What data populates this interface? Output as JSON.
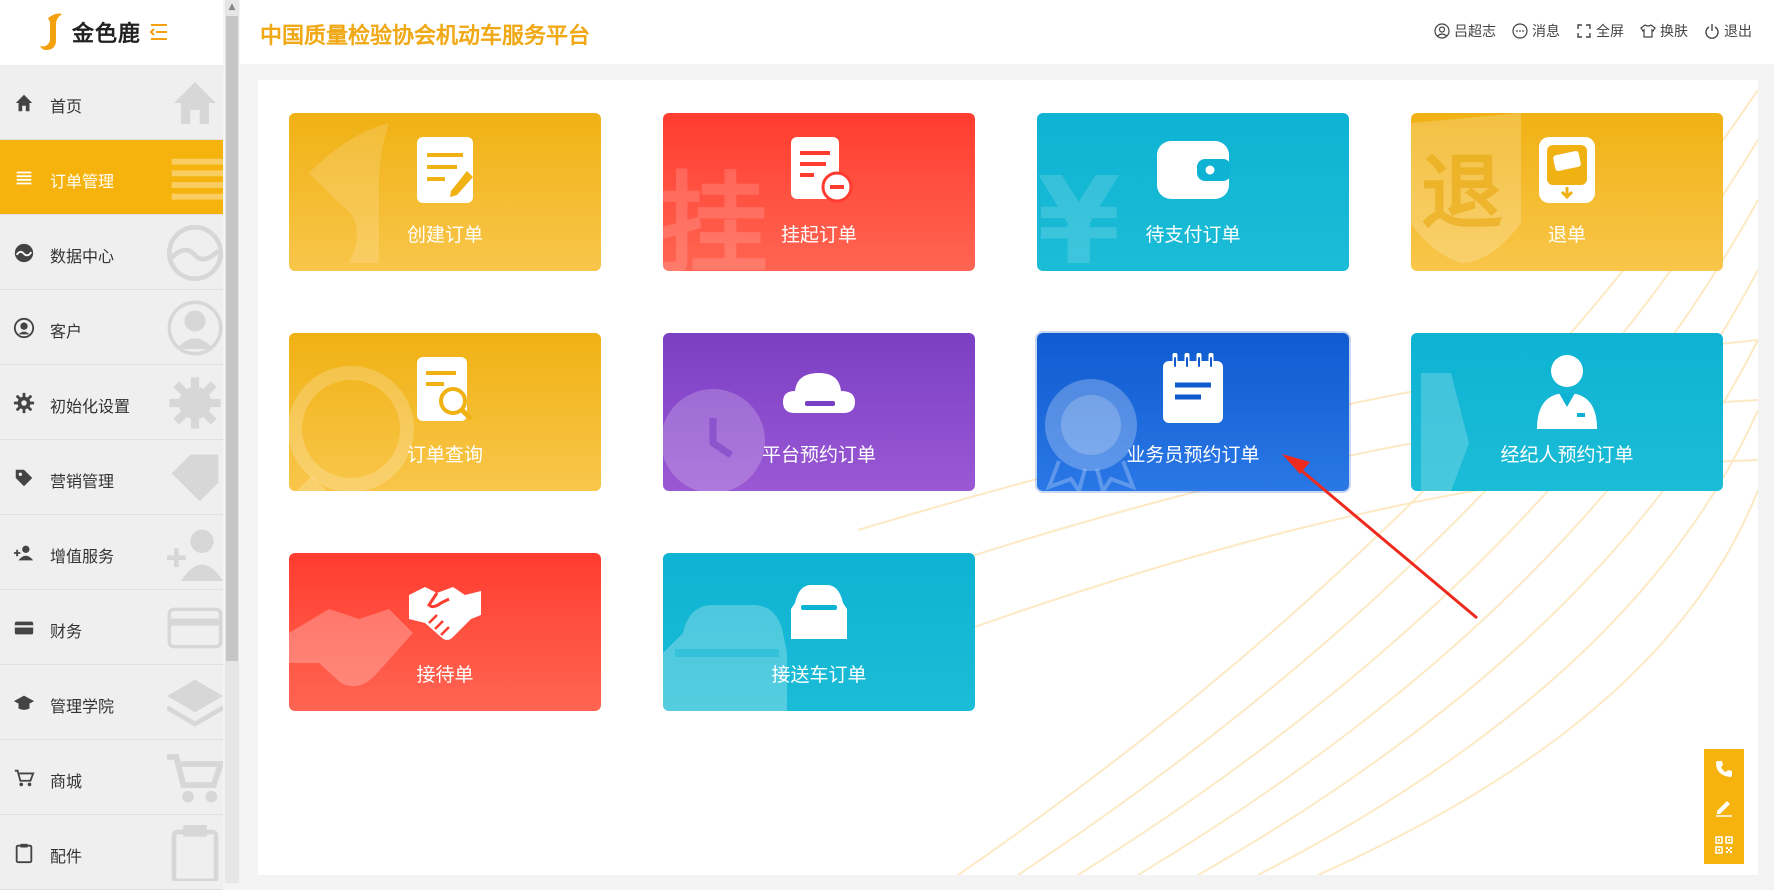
{
  "brand": {
    "name": "金色鹿"
  },
  "header": {
    "title": "中国质量检验协会机动车服务平台",
    "actions": [
      {
        "label": "吕超志",
        "icon": "user-icon"
      },
      {
        "label": "消息",
        "icon": "message-icon"
      },
      {
        "label": "全屏",
        "icon": "fullscreen-icon"
      },
      {
        "label": "换肤",
        "icon": "shirt-icon"
      },
      {
        "label": "退出",
        "icon": "power-icon"
      }
    ]
  },
  "sidebar": {
    "active_index": 1,
    "items": [
      {
        "label": "首页",
        "icon": "home-icon"
      },
      {
        "label": "订单管理",
        "icon": "list-icon"
      },
      {
        "label": "数据中心",
        "icon": "chart-icon"
      },
      {
        "label": "客户",
        "icon": "customer-icon"
      },
      {
        "label": "初始化设置",
        "icon": "gear-icon"
      },
      {
        "label": "营销管理",
        "icon": "tag-icon"
      },
      {
        "label": "增值服务",
        "icon": "add-user-icon"
      },
      {
        "label": "财务",
        "icon": "card-icon"
      },
      {
        "label": "管理学院",
        "icon": "graduation-icon"
      },
      {
        "label": "商城",
        "icon": "cart-icon"
      },
      {
        "label": "配件",
        "icon": "clipboard-icon"
      }
    ]
  },
  "tiles": [
    {
      "label": "创建订单",
      "icon": "create-order-icon",
      "color": "#f0b113"
    },
    {
      "label": "挂起订单",
      "icon": "suspend-order-icon",
      "color": "#ff3c2f",
      "watermark": "挂"
    },
    {
      "label": "待支付订单",
      "icon": "wallet-icon",
      "color": "#0eb3d3",
      "watermark": "¥"
    },
    {
      "label": "退单",
      "icon": "refund-icon",
      "color": "#f0b113",
      "watermark": "退"
    },
    {
      "label": "订单查询",
      "icon": "order-search-icon",
      "color": "#f0b113"
    },
    {
      "label": "平台预约订单",
      "icon": "cloud-icon",
      "color": "#7b3fc4"
    },
    {
      "label": "业务员预约订单",
      "icon": "notepad-icon",
      "color": "#0f5bd0"
    },
    {
      "label": "经纪人预约订单",
      "icon": "agent-icon",
      "color": "#0eb3d3"
    },
    {
      "label": "接待单",
      "icon": "handshake-icon",
      "color": "#ff3c2f"
    },
    {
      "label": "接送车订单",
      "icon": "car-icon",
      "color": "#0eb3d3"
    }
  ],
  "floating_tools": [
    {
      "icon": "phone-icon"
    },
    {
      "icon": "edit-icon"
    },
    {
      "icon": "qrcode-icon"
    }
  ],
  "colors": {
    "accent": "#f6b30d",
    "title": "#f0a815"
  }
}
